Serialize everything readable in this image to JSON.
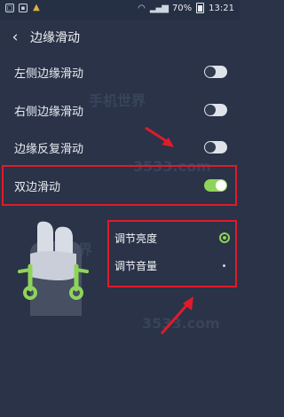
{
  "status_bar": {
    "battery": "70%",
    "time": "13:21"
  },
  "app_bar": {
    "title": "边缘滑动"
  },
  "settings": [
    {
      "label": "左侧边缘滑动",
      "enabled": false
    },
    {
      "label": "右侧边缘滑动",
      "enabled": false
    },
    {
      "label": "边缘反复滑动",
      "enabled": false
    },
    {
      "label": "双边滑动",
      "enabled": true
    }
  ],
  "options": [
    {
      "label": "调节亮度",
      "selected": true
    },
    {
      "label": "调节音量",
      "selected": false
    }
  ],
  "watermarks": [
    "手机世界",
    "3533.com",
    "手机世界",
    "3533.com"
  ],
  "colors": {
    "background": "#2a3347",
    "accent": "#8fd45a",
    "annotation": "#e01b2b"
  },
  "icons": {
    "back": "chevron-left-icon",
    "illustration": "two-finger-swipe-hand-icon"
  }
}
